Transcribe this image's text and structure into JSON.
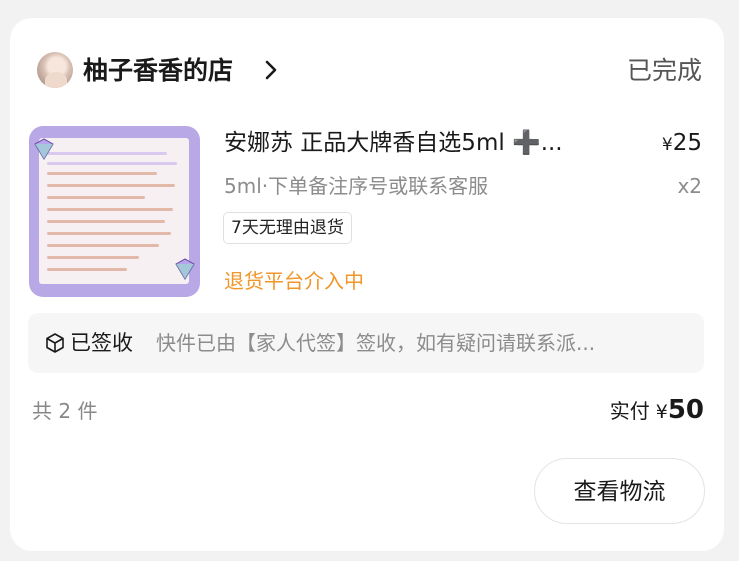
{
  "order": {
    "shop": {
      "name": "柚子香香的店",
      "status": "已完成"
    },
    "item": {
      "title": "安娜苏 正品大牌香自选5ml ➕...",
      "price_symbol": "¥",
      "price": "25",
      "spec": "5ml·下单备注序号或联系客服",
      "quantity": "x2",
      "service_tag": "7天无理由退货",
      "refund_status": "退货平台介入中"
    },
    "logistics": {
      "state": "已签收",
      "detail": "快件已由【家人代签】签收，如有疑问请联系派..."
    },
    "summary": {
      "count": "共 2 件",
      "paid_label": "实付",
      "currency": "¥",
      "amount": "50"
    },
    "actions": {
      "view_logistics": "查看物流"
    }
  },
  "colors": {
    "refund_status": "#f0962a",
    "thumbnail_bg": "#b9a8e6"
  },
  "icons": {
    "shop_chevron": "chevron-right-icon",
    "logistics": "package-icon"
  }
}
